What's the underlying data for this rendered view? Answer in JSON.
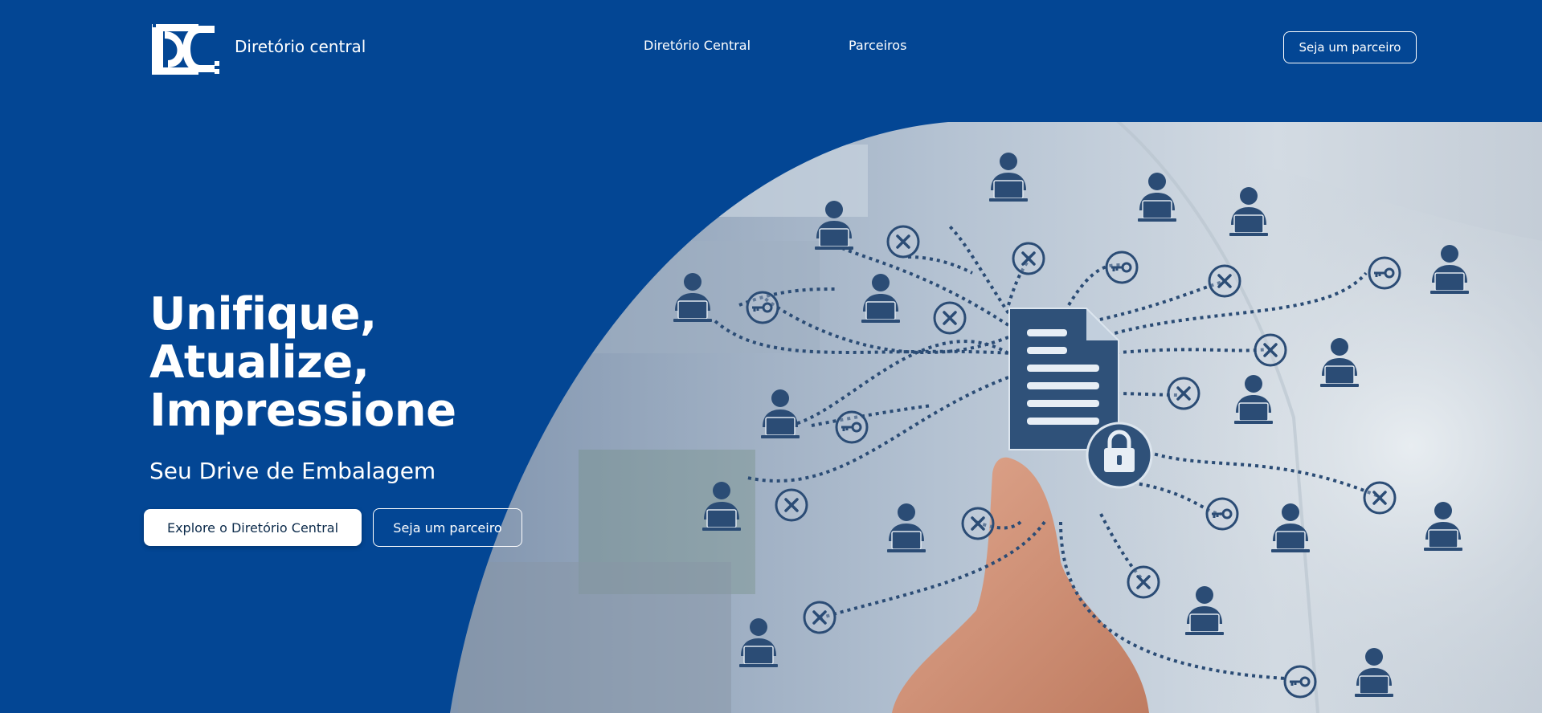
{
  "header": {
    "brand_name": "Diretório central",
    "nav": [
      {
        "label": "Diretório Central"
      },
      {
        "label": "Parceiros"
      }
    ],
    "cta_label": "Seja um parceiro"
  },
  "hero": {
    "title_lines": [
      "Unifique,",
      "Atualize,",
      "Impressione"
    ],
    "subtitle": "Seu Drive de Embalagem",
    "primary_button": "Explore o Diretório Central",
    "secondary_button": "Seja um parceiro",
    "image_icons": [
      "document-icon",
      "lock-icon",
      "user-icon",
      "key-icon",
      "close-icon"
    ]
  },
  "colors": {
    "background": "#034694",
    "text": "#ffffff",
    "icon_navy": "#2b4c75"
  }
}
